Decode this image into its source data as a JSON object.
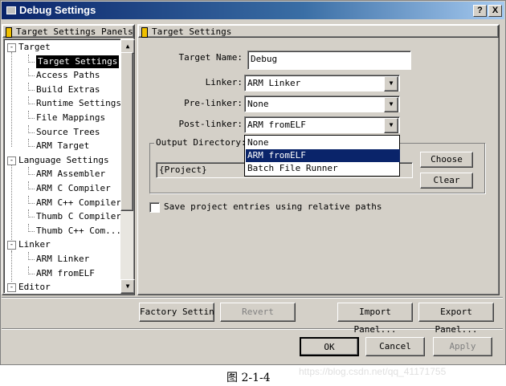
{
  "window": {
    "title": "Debug Settings",
    "help_button": "?",
    "close_button": "X"
  },
  "left_panel": {
    "header": "Target Settings Panels",
    "items": [
      {
        "label": "Target",
        "level": 0,
        "expander": "-"
      },
      {
        "label": "Target Settings",
        "level": 1,
        "selected": true
      },
      {
        "label": "Access Paths",
        "level": 1
      },
      {
        "label": "Build Extras",
        "level": 1
      },
      {
        "label": "Runtime Settings",
        "level": 1
      },
      {
        "label": "File Mappings",
        "level": 1
      },
      {
        "label": "Source Trees",
        "level": 1
      },
      {
        "label": "ARM Target",
        "level": 1
      },
      {
        "label": "Language Settings",
        "level": 0,
        "expander": "-"
      },
      {
        "label": "ARM Assembler",
        "level": 1
      },
      {
        "label": "ARM C Compiler",
        "level": 1
      },
      {
        "label": "ARM C++ Compiler",
        "level": 1
      },
      {
        "label": "Thumb C Compiler",
        "level": 1
      },
      {
        "label": "Thumb C++ Com...",
        "level": 1
      },
      {
        "label": "Linker",
        "level": 0,
        "expander": "-"
      },
      {
        "label": "ARM Linker",
        "level": 1
      },
      {
        "label": "ARM fromELF",
        "level": 1
      },
      {
        "label": "Editor",
        "level": 0,
        "expander": "-"
      }
    ]
  },
  "right_panel": {
    "header": "Target Settings",
    "target_name_label": "Target Name:",
    "target_name_value": "Debug",
    "linker_label": "Linker:",
    "linker_value": "ARM Linker",
    "prelinker_label": "Pre-linker:",
    "prelinker_value": "None",
    "postlinker_label": "Post-linker:",
    "postlinker_value": "ARM fromELF",
    "postlinker_options": [
      "None",
      "ARM fromELF",
      "Batch File Runner"
    ],
    "postlinker_highlighted": "ARM fromELF",
    "output_dir_legend": "Output Directory:",
    "output_dir_value": "{Project}",
    "choose_button": "Choose",
    "clear_button": "Clear",
    "relative_paths_label": "Save project entries using relative paths",
    "relative_paths_checked": false
  },
  "buttons_row1": {
    "factory": "Factory Settings",
    "revert": "Revert",
    "import": "Import Panel...",
    "export": "Export Panel..."
  },
  "buttons_row2": {
    "ok": "OK",
    "cancel": "Cancel",
    "apply": "Apply"
  },
  "caption": {
    "text": "图 2-1-4",
    "watermark": "https://blog.csdn.net/qq_41171755"
  },
  "colors": {
    "titlebar": "#0a246a",
    "face": "#d4d0c8",
    "highlight": "#0a246a"
  }
}
